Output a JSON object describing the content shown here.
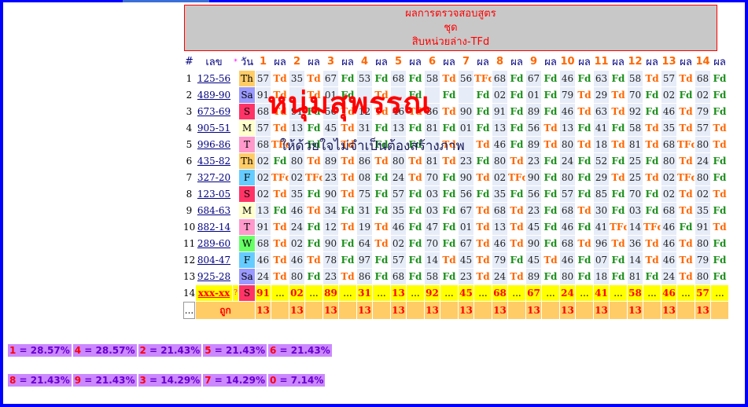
{
  "title": {
    "line1": "ผลการตรวจสอบสูตร",
    "line2": "ชุด",
    "line3": "สิบหน่วยล่าง-TFd"
  },
  "overlay": {
    "big": "หนุ่มสุพรรณ",
    "small": "ให้ด้วยใจไม่จำเป็นต้องสร้างภาพ"
  },
  "header": {
    "hash": "#",
    "num": "เลข",
    "star": "*",
    "day": "วัน",
    "result_label": "ผล",
    "cols": [
      "1",
      "2",
      "3",
      "4",
      "5",
      "6",
      "7",
      "8",
      "9",
      "10",
      "11",
      "12",
      "13",
      "14"
    ]
  },
  "colors": {
    "sa": "#9999ff",
    "th": "#ffcc66",
    "s": "#ff3366",
    "m": "#ffffcc",
    "t": "#ff99cc",
    "f": "#66ccff",
    "w": "#66ff66"
  },
  "rows": [
    {
      "i": "1",
      "num": "125-56",
      "day": "Th",
      "dc": "th",
      "cells": [
        [
          "57",
          "Td"
        ],
        [
          "35",
          "Td"
        ],
        [
          "67",
          "Fd"
        ],
        [
          "53",
          "Fd"
        ],
        [
          "68",
          "Fd"
        ],
        [
          "58",
          "Td"
        ],
        [
          "56",
          "TFd"
        ],
        [
          "68",
          "Fd"
        ],
        [
          "67",
          "Fd"
        ],
        [
          "46",
          "Fd"
        ],
        [
          "63",
          "Fd"
        ],
        [
          "58",
          "Td"
        ],
        [
          "57",
          "Td"
        ],
        [
          "68",
          "Fd"
        ]
      ]
    },
    {
      "i": "2",
      "num": "489-90",
      "day": "Sa",
      "dc": "sa",
      "cells": [
        [
          "91",
          "Td"
        ],
        [
          "",
          "Td"
        ],
        [
          "01",
          "Fd"
        ],
        [
          "",
          "Td"
        ],
        [
          "",
          "Fd"
        ],
        [
          "",
          "Fd"
        ],
        [
          "",
          "Fd"
        ],
        [
          "02",
          "Fd"
        ],
        [
          "01",
          "Fd"
        ],
        [
          "79",
          "Td"
        ],
        [
          "29",
          "Td"
        ],
        [
          "70",
          "Fd"
        ],
        [
          "02",
          "Fd"
        ],
        [
          "02",
          "Fd"
        ]
      ]
    },
    {
      "i": "3",
      "num": "673-69",
      "day": "S",
      "dc": "s",
      "cells": [
        [
          "68",
          "Td"
        ],
        [
          "91",
          "Fd"
        ],
        [
          "56",
          "Td"
        ],
        [
          "12",
          "Td"
        ],
        [
          "46",
          "Td"
        ],
        [
          "36",
          "Td"
        ],
        [
          "90",
          "Fd"
        ],
        [
          "91",
          "Fd"
        ],
        [
          "89",
          "Fd"
        ],
        [
          "46",
          "Td"
        ],
        [
          "63",
          "Td"
        ],
        [
          "92",
          "Fd"
        ],
        [
          "46",
          "Td"
        ],
        [
          "79",
          "Fd"
        ]
      ]
    },
    {
      "i": "4",
      "num": "905-51",
      "day": "M",
      "dc": "m",
      "cells": [
        [
          "57",
          "Td"
        ],
        [
          "13",
          "Fd"
        ],
        [
          "45",
          "Td"
        ],
        [
          "31",
          "Fd"
        ],
        [
          "13",
          "Fd"
        ],
        [
          "81",
          "Fd"
        ],
        [
          "01",
          "Fd"
        ],
        [
          "13",
          "Fd"
        ],
        [
          "56",
          "Td"
        ],
        [
          "13",
          "Fd"
        ],
        [
          "41",
          "Fd"
        ],
        [
          "58",
          "Td"
        ],
        [
          "35",
          "Td"
        ],
        [
          "57",
          "Td"
        ]
      ]
    },
    {
      "i": "5",
      "num": "996-86",
      "day": "T",
      "dc": "t",
      "cells": [
        [
          "68",
          "TFd"
        ],
        [
          "",
          "Fd"
        ],
        [
          "",
          "Td"
        ],
        [
          "",
          "Fd"
        ],
        [
          "",
          "Fd"
        ],
        [
          "",
          "Td"
        ],
        [
          "",
          "Td"
        ],
        [
          "46",
          "Fd"
        ],
        [
          "89",
          "Td"
        ],
        [
          "80",
          "Td"
        ],
        [
          "18",
          "Td"
        ],
        [
          "81",
          "Td"
        ],
        [
          "68",
          "TFd"
        ],
        [
          "80",
          "Td"
        ]
      ]
    },
    {
      "i": "6",
      "num": "435-82",
      "day": "Th",
      "dc": "th",
      "cells": [
        [
          "02",
          "Fd"
        ],
        [
          "80",
          "Td"
        ],
        [
          "89",
          "Td"
        ],
        [
          "86",
          "Td"
        ],
        [
          "80",
          "Td"
        ],
        [
          "81",
          "Td"
        ],
        [
          "23",
          "Fd"
        ],
        [
          "80",
          "Td"
        ],
        [
          "23",
          "Fd"
        ],
        [
          "24",
          "Fd"
        ],
        [
          "52",
          "Fd"
        ],
        [
          "25",
          "Fd"
        ],
        [
          "80",
          "Td"
        ],
        [
          "24",
          "Fd"
        ]
      ]
    },
    {
      "i": "7",
      "num": "327-20",
      "day": "F",
      "dc": "f",
      "cells": [
        [
          "02",
          "TFd"
        ],
        [
          "02",
          "TFd"
        ],
        [
          "23",
          "Td"
        ],
        [
          "08",
          "Fd"
        ],
        [
          "24",
          "Td"
        ],
        [
          "70",
          "Fd"
        ],
        [
          "90",
          "Td"
        ],
        [
          "02",
          "TFd"
        ],
        [
          "90",
          "Fd"
        ],
        [
          "80",
          "Fd"
        ],
        [
          "29",
          "Td"
        ],
        [
          "25",
          "Td"
        ],
        [
          "02",
          "TFd"
        ],
        [
          "80",
          "Fd"
        ]
      ]
    },
    {
      "i": "8",
      "num": "123-05",
      "day": "S",
      "dc": "s",
      "cells": [
        [
          "02",
          "Td"
        ],
        [
          "35",
          "Fd"
        ],
        [
          "90",
          "Td"
        ],
        [
          "75",
          "Fd"
        ],
        [
          "57",
          "Fd"
        ],
        [
          "03",
          "Fd"
        ],
        [
          "56",
          "Fd"
        ],
        [
          "35",
          "Fd"
        ],
        [
          "56",
          "Fd"
        ],
        [
          "57",
          "Fd"
        ],
        [
          "85",
          "Fd"
        ],
        [
          "70",
          "Fd"
        ],
        [
          "02",
          "Td"
        ],
        [
          "02",
          "Td"
        ]
      ]
    },
    {
      "i": "9",
      "num": "684-63",
      "day": "M",
      "dc": "m",
      "cells": [
        [
          "13",
          "Fd"
        ],
        [
          "46",
          "Td"
        ],
        [
          "34",
          "Fd"
        ],
        [
          "31",
          "Fd"
        ],
        [
          "35",
          "Fd"
        ],
        [
          "03",
          "Fd"
        ],
        [
          "67",
          "Td"
        ],
        [
          "68",
          "Td"
        ],
        [
          "23",
          "Fd"
        ],
        [
          "68",
          "Td"
        ],
        [
          "30",
          "Fd"
        ],
        [
          "03",
          "Fd"
        ],
        [
          "68",
          "Td"
        ],
        [
          "35",
          "Fd"
        ]
      ]
    },
    {
      "i": "10",
      "num": "882-14",
      "day": "T",
      "dc": "t",
      "cells": [
        [
          "91",
          "Td"
        ],
        [
          "24",
          "Fd"
        ],
        [
          "12",
          "Td"
        ],
        [
          "19",
          "Td"
        ],
        [
          "46",
          "Fd"
        ],
        [
          "47",
          "Fd"
        ],
        [
          "01",
          "Td"
        ],
        [
          "13",
          "Td"
        ],
        [
          "45",
          "Fd"
        ],
        [
          "46",
          "Fd"
        ],
        [
          "41",
          "TFd"
        ],
        [
          "14",
          "TFd"
        ],
        [
          "46",
          "Fd"
        ],
        [
          "91",
          "Td"
        ]
      ]
    },
    {
      "i": "11",
      "num": "289-60",
      "day": "W",
      "dc": "w",
      "cells": [
        [
          "68",
          "Td"
        ],
        [
          "02",
          "Fd"
        ],
        [
          "90",
          "Fd"
        ],
        [
          "64",
          "Td"
        ],
        [
          "02",
          "Fd"
        ],
        [
          "70",
          "Fd"
        ],
        [
          "67",
          "Td"
        ],
        [
          "46",
          "Td"
        ],
        [
          "90",
          "Fd"
        ],
        [
          "68",
          "Td"
        ],
        [
          "96",
          "Td"
        ],
        [
          "36",
          "Td"
        ],
        [
          "46",
          "Td"
        ],
        [
          "80",
          "Fd"
        ]
      ]
    },
    {
      "i": "12",
      "num": "804-47",
      "day": "F",
      "dc": "f",
      "cells": [
        [
          "46",
          "Td"
        ],
        [
          "46",
          "Td"
        ],
        [
          "78",
          "Fd"
        ],
        [
          "97",
          "Fd"
        ],
        [
          "57",
          "Fd"
        ],
        [
          "14",
          "Td"
        ],
        [
          "45",
          "Td"
        ],
        [
          "79",
          "Fd"
        ],
        [
          "45",
          "Td"
        ],
        [
          "46",
          "Fd"
        ],
        [
          "07",
          "Fd"
        ],
        [
          "14",
          "Td"
        ],
        [
          "46",
          "Td"
        ],
        [
          "79",
          "Fd"
        ]
      ]
    },
    {
      "i": "13",
      "num": "925-28",
      "day": "Sa",
      "dc": "sa",
      "cells": [
        [
          "24",
          "Td"
        ],
        [
          "80",
          "Fd"
        ],
        [
          "23",
          "Td"
        ],
        [
          "86",
          "Fd"
        ],
        [
          "68",
          "Fd"
        ],
        [
          "58",
          "Fd"
        ],
        [
          "23",
          "Td"
        ],
        [
          "24",
          "Td"
        ],
        [
          "89",
          "Fd"
        ],
        [
          "80",
          "Fd"
        ],
        [
          "18",
          "Fd"
        ],
        [
          "81",
          "Fd"
        ],
        [
          "24",
          "Td"
        ],
        [
          "80",
          "Fd"
        ]
      ]
    }
  ],
  "prediction": {
    "i": "14",
    "num": "xxx-xx",
    "q": "?",
    "day": "S",
    "dc": "s",
    "cells": [
      "91",
      "02",
      "89",
      "31",
      "13",
      "92",
      "45",
      "68",
      "67",
      "24",
      "41",
      "58",
      "46",
      "57"
    ],
    "dots": "..."
  },
  "summary": {
    "label_left": "...",
    "label": "ถูก",
    "cells": [
      "13",
      "13",
      "13",
      "13",
      "13",
      "13",
      "13",
      "13",
      "13",
      "13",
      "13",
      "13",
      "13",
      "13"
    ]
  },
  "stats_row1": [
    {
      "k": "1",
      "v": "28.57%"
    },
    {
      "k": "4",
      "v": "28.57%"
    },
    {
      "k": "2",
      "v": "21.43%"
    },
    {
      "k": "5",
      "v": "21.43%"
    },
    {
      "k": "6",
      "v": "21.43%"
    }
  ],
  "stats_row2": [
    {
      "k": "8",
      "v": "21.43%"
    },
    {
      "k": "9",
      "v": "21.43%"
    },
    {
      "k": "3",
      "v": "14.29%"
    },
    {
      "k": "7",
      "v": "14.29%"
    },
    {
      "k": "0",
      "v": "7.14%"
    }
  ]
}
